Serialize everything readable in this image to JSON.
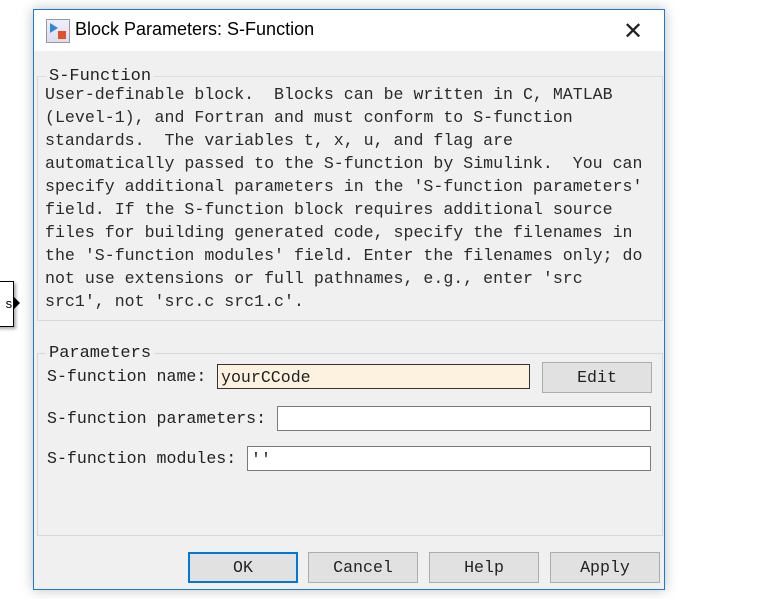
{
  "background": {
    "block_label": "si"
  },
  "dialog": {
    "title": "Block Parameters: S-Function",
    "description_group": "S-Function",
    "description": "User-definable block.  Blocks can be written in C, MATLAB\n(Level-1), and Fortran and must conform to S-function\nstandards.  The variables t, x, u, and flag are\nautomatically passed to the S-function by Simulink.  You can\nspecify additional parameters in the 'S-function parameters'\nfield. If the S-function block requires additional source\nfiles for building generated code, specify the filenames in\nthe 'S-function modules' field. Enter the filenames only; do\nnot use extensions or full pathnames, e.g., enter 'src\nsrc1', not 'src.c src1.c'.",
    "parameters_group": "Parameters",
    "fields": {
      "name_label": "S-function name:",
      "name_value": "yourCCode",
      "edit_label": "Edit",
      "params_label": "S-function parameters:",
      "params_value": "",
      "modules_label": "S-function modules:",
      "modules_value": "''"
    },
    "buttons": {
      "ok": "OK",
      "cancel": "Cancel",
      "help": "Help",
      "apply": "Apply"
    },
    "colors": {
      "accent": "#0078d7",
      "highlight_field": "#fdf2e0"
    }
  }
}
